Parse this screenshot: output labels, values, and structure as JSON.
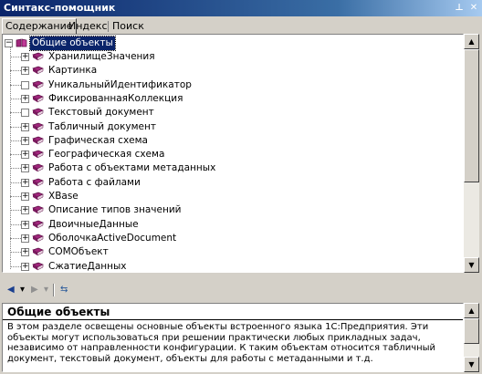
{
  "window": {
    "title": "Синтакс-помощник",
    "pin_glyph": "⊥",
    "close_glyph": "✕"
  },
  "tabs": [
    {
      "label": "Содержание",
      "active": true
    },
    {
      "label": "Индекс",
      "active": false
    },
    {
      "label": "Поиск",
      "active": false
    }
  ],
  "tree": {
    "root": {
      "label": "Общие объекты",
      "expander": "−",
      "icon": "open-book-icon"
    },
    "items": [
      {
        "label": "ХранилищеЗначения",
        "expander": "+"
      },
      {
        "label": "Картинка",
        "expander": "+"
      },
      {
        "label": "УникальныйИдентификатор",
        "expander": ""
      },
      {
        "label": "ФиксированнаяКоллекция",
        "expander": "+"
      },
      {
        "label": "Текстовый документ",
        "expander": ""
      },
      {
        "label": "Табличный документ",
        "expander": "+"
      },
      {
        "label": "Графическая схема",
        "expander": "+"
      },
      {
        "label": "Географическая схема",
        "expander": "+"
      },
      {
        "label": "Работа с объектами метаданных",
        "expander": "+"
      },
      {
        "label": "Работа с файлами",
        "expander": "+"
      },
      {
        "label": "XBase",
        "expander": "+"
      },
      {
        "label": "Описание типов значений",
        "expander": "+"
      },
      {
        "label": "ДвоичныеДанные",
        "expander": "+"
      },
      {
        "label": "ОболочкаActiveDocument",
        "expander": "+"
      },
      {
        "label": "COMОбъект",
        "expander": "+"
      },
      {
        "label": "СжатиеДанных",
        "expander": "+"
      }
    ],
    "book_color": "#a0267c"
  },
  "toolbar": {
    "back": "◀",
    "back_dropdown": "▾",
    "forward": "▶",
    "forward_dropdown": "▾",
    "sync": "⇆"
  },
  "description": {
    "heading": "Общие объекты",
    "body": "В этом разделе освещены основные объекты встроенного языка 1С:Предприятия. Эти объекты могут использоваться при решении практически любых прикладных задач, независимо от направленности конфигурации. К таким объектам относится табличный документ, текстовый документ, объекты для работы с метаданными и т.д."
  },
  "scrollbar": {
    "up": "▲",
    "down": "▼"
  }
}
